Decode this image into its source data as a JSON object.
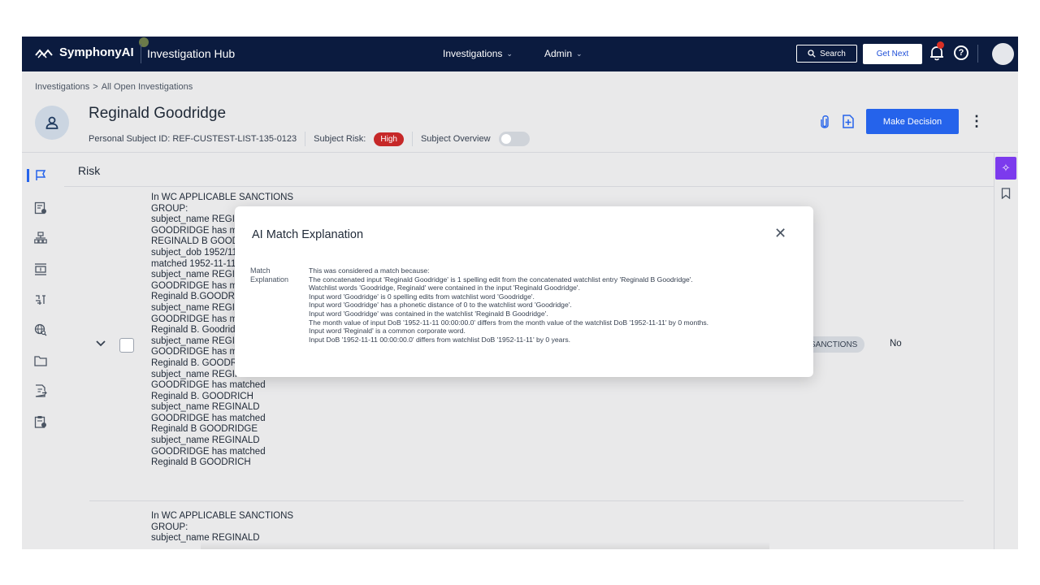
{
  "app": {
    "brand": "SymphonyAI",
    "hub": "Investigation Hub"
  },
  "nav": {
    "investigations": "Investigations",
    "admin": "Admin",
    "search": "Search",
    "get_next": "Get Next"
  },
  "breadcrumb": {
    "root": "Investigations",
    "separator": ">",
    "current": "All Open Investigations"
  },
  "subject": {
    "name": "Reginald Goodridge",
    "id_text": "Personal Subject ID: REF-CUSTEST-LIST-135-0123",
    "risk_label": "Subject Risk:",
    "risk_value": "High",
    "overview_label": "Subject Overview"
  },
  "actions": {
    "make_decision": "Make Decision"
  },
  "risk": {
    "section_title": "Risk",
    "row1_lines": [
      "In WC APPLICABLE SANCTIONS",
      "GROUP:",
      "subject_name REGINALD",
      "GOODRIDGE has matched",
      "REGINALD B GOODRIDGE",
      "subject_dob 1952/11/11 has",
      "matched 1952-11-11",
      "subject_name REGINALD",
      "GOODRIDGE has matched",
      "Reginald B.GOODRIDGE",
      "subject_name REGINALD",
      "GOODRIDGE has matched",
      "Reginald B. Goodridge",
      "subject_name REGINALD",
      "GOODRIDGE has matched",
      "Reginald B. GOODRIDGE",
      "subject_name REGINALD",
      "GOODRIDGE has matched",
      "Reginald B. GOODRICH",
      "subject_name REGINALD",
      "GOODRIDGE has matched",
      "Reginald B GOODRIDGE",
      "subject_name REGINALD",
      "GOODRIDGE has matched",
      "Reginald B GOODRICH"
    ],
    "row2_lines": [
      "In WC APPLICABLE SANCTIONS",
      "GROUP:",
      "subject_name REGINALD"
    ],
    "chip": "SANCTIONS",
    "decision": "No"
  },
  "modal": {
    "title": "AI Match Explanation",
    "label": "Match Explanation",
    "lines": [
      "This was considered a match because:",
      "The concatenated input 'Reginald Goodridge' is 1 spelling edit from the concatenated watchlist entry 'Reginald B Goodridge'.",
      "Watchlist words 'Goodridge, Reginald' were contained in the input 'Reginald Goodridge'.",
      "Input word 'Goodridge' is 0 spelling edits from watchlist word 'Goodridge'.",
      "Input word 'Goodridge' has a phonetic distance of 0 to the watchlist word 'Goodridge'.",
      "Input word 'Goodridge' was contained in the watchlist 'Reginald B Goodridge'.",
      "The month value of input DoB '1952-11-11 00:00:00.0' differs from the month value of the watchlist DoB '1952-11-11' by 0 months.",
      "Input word 'Reginald' is a common corporate word.",
      "Input DoB '1952-11-11 00:00:00.0' differs from watchlist DoB '1952-11-11' by 0 years."
    ]
  },
  "icons": {
    "brand_mark": "symphony-logo-icon",
    "notifications": "bell-icon",
    "help": "help-icon",
    "attachment": "paperclip-icon",
    "add_file": "add-file-icon",
    "ai_assistant": "sparkle-icon"
  },
  "colors": {
    "nav_bg": "#0b1b3f",
    "primary": "#2563eb",
    "risk_high": "#c62828",
    "ai_purple": "#7c3aed"
  }
}
